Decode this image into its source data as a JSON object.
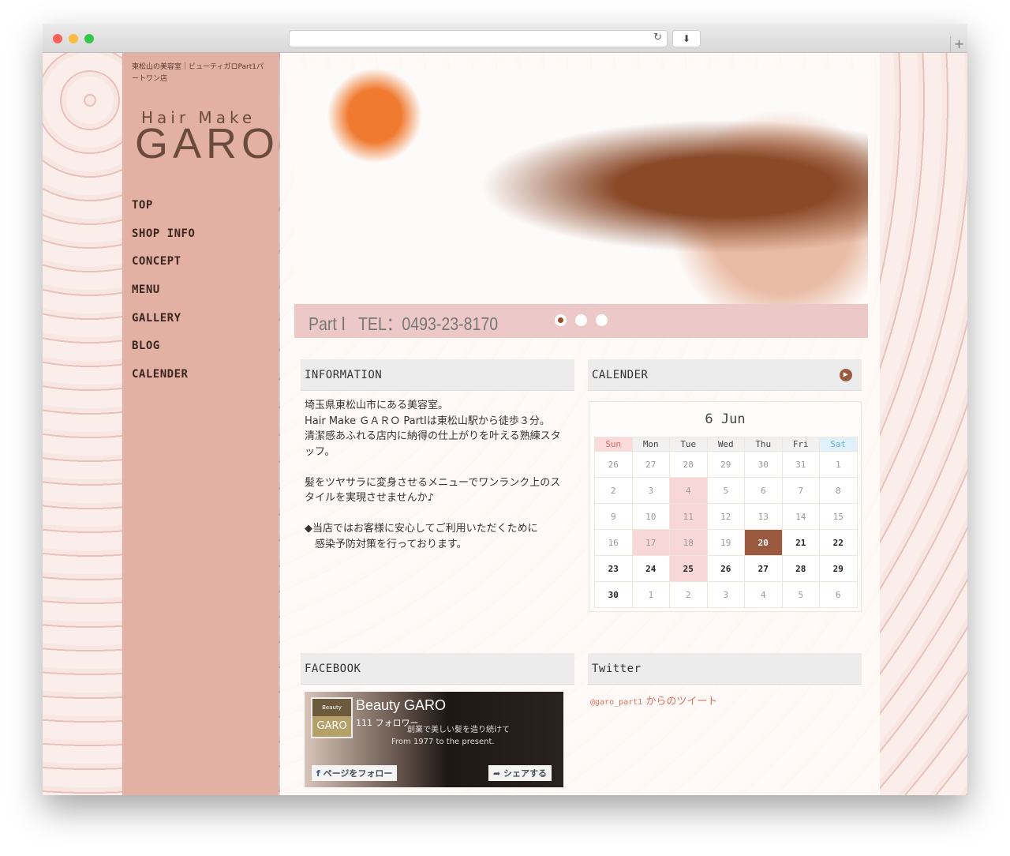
{
  "browser": {
    "reload_icon": "reload-icon",
    "download_icon": "download-icon",
    "new_tab": "+"
  },
  "sidebar": {
    "tagline": "東松山の美容室｜ビューティガロPart1パートワン店",
    "logo_small": "Hair Make",
    "logo_big": "GARO",
    "nav": [
      "TOP",
      "SHOP INFO",
      "CONCEPT",
      "MENU",
      "GALLERY",
      "BLOG",
      "CALENDER"
    ]
  },
  "banner": {
    "tel": "Part Ⅰ   TEL：0493-23-8170",
    "slides": 3,
    "active_slide": 1,
    "accent": "#9b4a30"
  },
  "information": {
    "heading": "INFORMATION",
    "paragraphs": [
      "埼玉県東松山市にある美容室。\nHair Make ＧＡＲＯ PartⅠは東松山駅から徒歩３分。\n清潔感あふれる店内に納得の仕上がりを叶える熟練スタッフ。",
      "髪をツヤサラに変身させるメニューでワンランク上のスタイルを実現させませんか♪",
      "◆当店ではお客様に安心してご利用いただくために\n　感染予防対策を行っております。"
    ]
  },
  "calendar": {
    "heading": "CALENDER",
    "title": "6 Jun",
    "weekdays": [
      "Sun",
      "Mon",
      "Tue",
      "Wed",
      "Thu",
      "Fri",
      "Sat"
    ],
    "weeks": [
      [
        "26",
        "27",
        "28",
        "29",
        "30",
        "31",
        "1"
      ],
      [
        "2",
        "3",
        "4",
        "5",
        "6",
        "7",
        "8"
      ],
      [
        "9",
        "10",
        "11",
        "12",
        "13",
        "14",
        "15"
      ],
      [
        "16",
        "17",
        "18",
        "19",
        "20",
        "21",
        "22"
      ],
      [
        "23",
        "24",
        "25",
        "26",
        "27",
        "28",
        "29"
      ],
      [
        "30",
        "1",
        "2",
        "3",
        "4",
        "5",
        "6"
      ]
    ],
    "holidays": [
      "4",
      "11",
      "17",
      "18",
      "25"
    ],
    "today": "20",
    "today_color": "#9b5a40"
  },
  "facebook": {
    "heading": "FACEBOOK",
    "page_name": "Beauty GARO",
    "followers": "111 フォロワー",
    "logo_top": "Beauty",
    "logo_bottom": "GARO",
    "cover_text1": "創業で美しい髪を造り続けて",
    "cover_text2": "From 1977 to the present.",
    "follow_label": "ページをフォロー",
    "share_label": "シェアする"
  },
  "twitter": {
    "heading": "Twitter",
    "handle": "@garo_part1",
    "link_suffix": " からのツイート"
  }
}
